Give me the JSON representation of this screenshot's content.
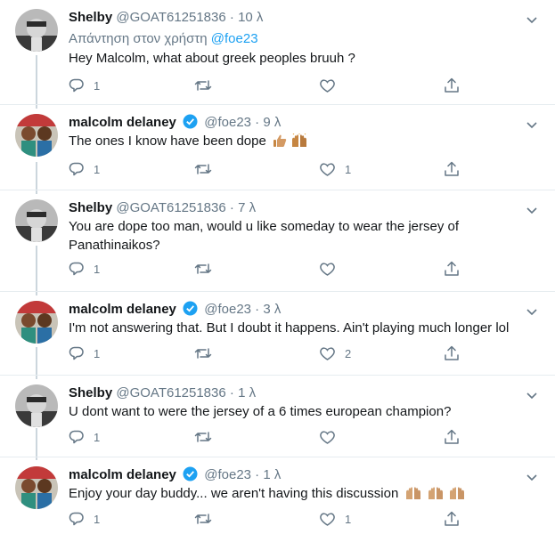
{
  "tweets": [
    {
      "name": "Shelby",
      "handle": "@GOAT61251836",
      "dot": "·",
      "time": "10 λ",
      "reply_prefix": "Απάντηση στον χρήστη",
      "reply_to": "@foe23",
      "text": "Hey Malcolm, what about greek peoples bruuh ?",
      "reply_count": "1",
      "retweet_count": "",
      "like_count": ""
    },
    {
      "name": "malcolm delaney",
      "handle": "@foe23",
      "dot": "·",
      "time": "9 λ",
      "text": "The ones I know have been dope",
      "reply_count": "1",
      "retweet_count": "",
      "like_count": "1"
    },
    {
      "name": "Shelby",
      "handle": "@GOAT61251836",
      "dot": "·",
      "time": "7 λ",
      "text": "You are dope too man, would u like someday to wear the jersey of Panathinaikos?",
      "reply_count": "1",
      "retweet_count": "",
      "like_count": ""
    },
    {
      "name": "malcolm delaney",
      "handle": "@foe23",
      "dot": "·",
      "time": "3 λ",
      "text": "I'm not answering that. But I doubt it happens. Ain't playing much longer lol",
      "reply_count": "1",
      "retweet_count": "",
      "like_count": "2"
    },
    {
      "name": "Shelby",
      "handle": "@GOAT61251836",
      "dot": "·",
      "time": "1 λ",
      "text": "U dont want to were the jersey of a 6 times european champion?",
      "reply_count": "1",
      "retweet_count": "",
      "like_count": ""
    },
    {
      "name": "malcolm delaney",
      "handle": "@foe23",
      "dot": "·",
      "time": "1 λ",
      "text": "Enjoy your day buddy... we aren't having this discussion",
      "reply_count": "1",
      "retweet_count": "",
      "like_count": "1"
    }
  ],
  "colors": {
    "accent": "#1da1f2",
    "muted": "#657786",
    "text": "#14171a",
    "thread_line": "#ccd6dd"
  },
  "icons": [
    "reply-icon",
    "retweet-icon",
    "like-icon",
    "share-icon",
    "verified-icon",
    "caret-down-icon"
  ]
}
